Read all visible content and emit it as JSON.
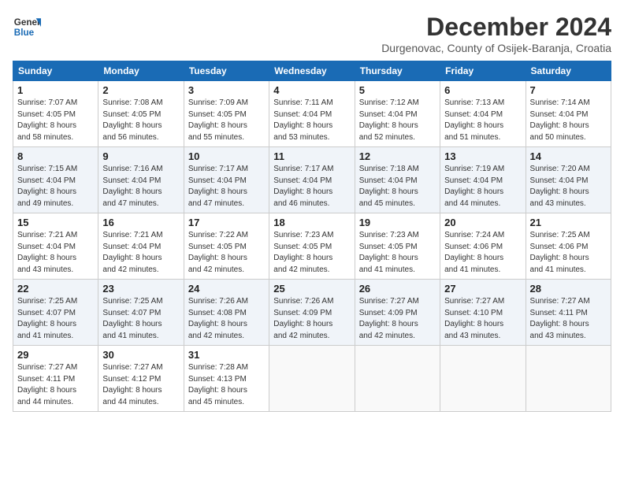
{
  "logo": {
    "line1": "General",
    "line2": "Blue"
  },
  "title": "December 2024",
  "subtitle": "Durgenovac, County of Osijek-Baranja, Croatia",
  "weekdays": [
    "Sunday",
    "Monday",
    "Tuesday",
    "Wednesday",
    "Thursday",
    "Friday",
    "Saturday"
  ],
  "weeks": [
    [
      {
        "day": "1",
        "info": "Sunrise: 7:07 AM\nSunset: 4:05 PM\nDaylight: 8 hours\nand 58 minutes."
      },
      {
        "day": "2",
        "info": "Sunrise: 7:08 AM\nSunset: 4:05 PM\nDaylight: 8 hours\nand 56 minutes."
      },
      {
        "day": "3",
        "info": "Sunrise: 7:09 AM\nSunset: 4:05 PM\nDaylight: 8 hours\nand 55 minutes."
      },
      {
        "day": "4",
        "info": "Sunrise: 7:11 AM\nSunset: 4:04 PM\nDaylight: 8 hours\nand 53 minutes."
      },
      {
        "day": "5",
        "info": "Sunrise: 7:12 AM\nSunset: 4:04 PM\nDaylight: 8 hours\nand 52 minutes."
      },
      {
        "day": "6",
        "info": "Sunrise: 7:13 AM\nSunset: 4:04 PM\nDaylight: 8 hours\nand 51 minutes."
      },
      {
        "day": "7",
        "info": "Sunrise: 7:14 AM\nSunset: 4:04 PM\nDaylight: 8 hours\nand 50 minutes."
      }
    ],
    [
      {
        "day": "8",
        "info": "Sunrise: 7:15 AM\nSunset: 4:04 PM\nDaylight: 8 hours\nand 49 minutes."
      },
      {
        "day": "9",
        "info": "Sunrise: 7:16 AM\nSunset: 4:04 PM\nDaylight: 8 hours\nand 47 minutes."
      },
      {
        "day": "10",
        "info": "Sunrise: 7:17 AM\nSunset: 4:04 PM\nDaylight: 8 hours\nand 47 minutes."
      },
      {
        "day": "11",
        "info": "Sunrise: 7:17 AM\nSunset: 4:04 PM\nDaylight: 8 hours\nand 46 minutes."
      },
      {
        "day": "12",
        "info": "Sunrise: 7:18 AM\nSunset: 4:04 PM\nDaylight: 8 hours\nand 45 minutes."
      },
      {
        "day": "13",
        "info": "Sunrise: 7:19 AM\nSunset: 4:04 PM\nDaylight: 8 hours\nand 44 minutes."
      },
      {
        "day": "14",
        "info": "Sunrise: 7:20 AM\nSunset: 4:04 PM\nDaylight: 8 hours\nand 43 minutes."
      }
    ],
    [
      {
        "day": "15",
        "info": "Sunrise: 7:21 AM\nSunset: 4:04 PM\nDaylight: 8 hours\nand 43 minutes."
      },
      {
        "day": "16",
        "info": "Sunrise: 7:21 AM\nSunset: 4:04 PM\nDaylight: 8 hours\nand 42 minutes."
      },
      {
        "day": "17",
        "info": "Sunrise: 7:22 AM\nSunset: 4:05 PM\nDaylight: 8 hours\nand 42 minutes."
      },
      {
        "day": "18",
        "info": "Sunrise: 7:23 AM\nSunset: 4:05 PM\nDaylight: 8 hours\nand 42 minutes."
      },
      {
        "day": "19",
        "info": "Sunrise: 7:23 AM\nSunset: 4:05 PM\nDaylight: 8 hours\nand 41 minutes."
      },
      {
        "day": "20",
        "info": "Sunrise: 7:24 AM\nSunset: 4:06 PM\nDaylight: 8 hours\nand 41 minutes."
      },
      {
        "day": "21",
        "info": "Sunrise: 7:25 AM\nSunset: 4:06 PM\nDaylight: 8 hours\nand 41 minutes."
      }
    ],
    [
      {
        "day": "22",
        "info": "Sunrise: 7:25 AM\nSunset: 4:07 PM\nDaylight: 8 hours\nand 41 minutes."
      },
      {
        "day": "23",
        "info": "Sunrise: 7:25 AM\nSunset: 4:07 PM\nDaylight: 8 hours\nand 41 minutes."
      },
      {
        "day": "24",
        "info": "Sunrise: 7:26 AM\nSunset: 4:08 PM\nDaylight: 8 hours\nand 42 minutes."
      },
      {
        "day": "25",
        "info": "Sunrise: 7:26 AM\nSunset: 4:09 PM\nDaylight: 8 hours\nand 42 minutes."
      },
      {
        "day": "26",
        "info": "Sunrise: 7:27 AM\nSunset: 4:09 PM\nDaylight: 8 hours\nand 42 minutes."
      },
      {
        "day": "27",
        "info": "Sunrise: 7:27 AM\nSunset: 4:10 PM\nDaylight: 8 hours\nand 43 minutes."
      },
      {
        "day": "28",
        "info": "Sunrise: 7:27 AM\nSunset: 4:11 PM\nDaylight: 8 hours\nand 43 minutes."
      }
    ],
    [
      {
        "day": "29",
        "info": "Sunrise: 7:27 AM\nSunset: 4:11 PM\nDaylight: 8 hours\nand 44 minutes."
      },
      {
        "day": "30",
        "info": "Sunrise: 7:27 AM\nSunset: 4:12 PM\nDaylight: 8 hours\nand 44 minutes."
      },
      {
        "day": "31",
        "info": "Sunrise: 7:28 AM\nSunset: 4:13 PM\nDaylight: 8 hours\nand 45 minutes."
      },
      null,
      null,
      null,
      null
    ]
  ]
}
